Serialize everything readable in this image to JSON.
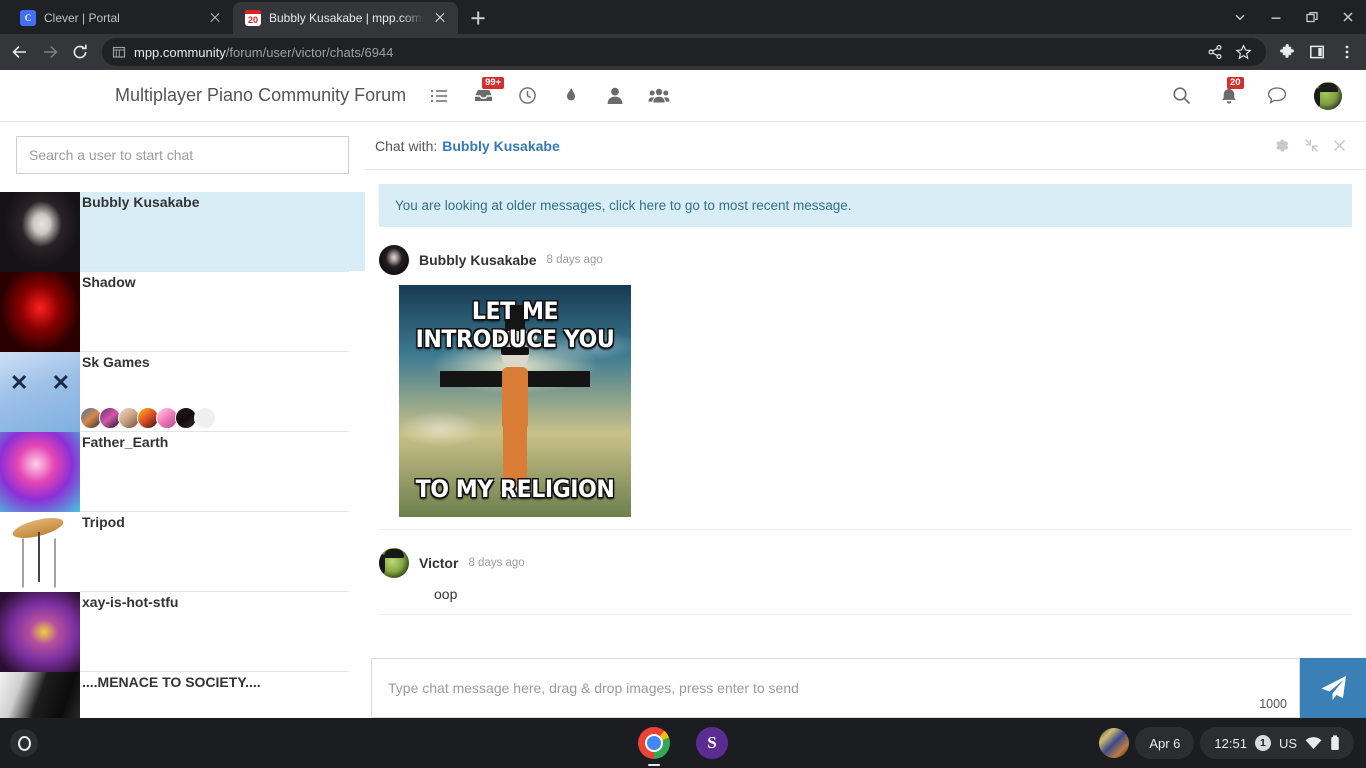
{
  "browser": {
    "tabs": [
      {
        "title": "Clever | Portal",
        "favicon": "clever-icon",
        "favicon_letter": "C",
        "active": false
      },
      {
        "title": "Bubbly Kusakabe | mpp.commu",
        "favicon": "calendar-icon",
        "favicon_badge": "20",
        "active": true
      }
    ],
    "new_tab_label": "+",
    "window_controls": [
      "chevron-down-icon",
      "minimize-icon",
      "restore-icon",
      "close-icon"
    ],
    "nav": {
      "back": "back-arrow-icon",
      "forward": "forward-arrow-icon",
      "reload": "reload-icon"
    },
    "omnibox": {
      "site_icon": "site-info-icon",
      "url_domain": "mpp.community",
      "url_path": "/forum/user/victor/chats/6944"
    },
    "omnibox_actions": [
      "share-icon",
      "bookmark-star-icon"
    ],
    "toolbar_icons": [
      "extensions-puzzle-icon",
      "side-panel-icon",
      "chrome-menu-icon"
    ]
  },
  "site": {
    "brand": "Multiplayer Piano Community Forum",
    "nav_icons": [
      {
        "name": "list-icon",
        "badge": ""
      },
      {
        "name": "inbox-icon",
        "badge": "99+"
      },
      {
        "name": "clock-icon",
        "badge": ""
      },
      {
        "name": "flame-icon",
        "badge": ""
      },
      {
        "name": "user-icon",
        "badge": ""
      },
      {
        "name": "group-icon",
        "badge": ""
      }
    ],
    "right_icons": [
      {
        "name": "search-icon",
        "badge": ""
      },
      {
        "name": "bell-icon",
        "badge": "20"
      },
      {
        "name": "chat-bubble-icon",
        "badge": ""
      }
    ],
    "avatar": "user-avatar"
  },
  "sidebar": {
    "search_placeholder": "Search a user to start chat",
    "search_value": "",
    "chats": [
      {
        "name": "Bubbly Kusakabe",
        "active": true,
        "thumb": "th-bubbly",
        "members": 0
      },
      {
        "name": "Shadow",
        "active": false,
        "thumb": "th-shadow",
        "members": 0
      },
      {
        "name": "Sk Games",
        "active": false,
        "thumb": "th-sk",
        "members": 7
      },
      {
        "name": "Father_Earth",
        "active": false,
        "thumb": "th-father",
        "members": 0
      },
      {
        "name": "Tripod",
        "active": false,
        "thumb": "th-tripod",
        "members": 0
      },
      {
        "name": "xay-is-hot-stfu",
        "active": false,
        "thumb": "th-xay",
        "members": 0
      },
      {
        "name": "....MENACE TO SOCIETY....",
        "active": false,
        "thumb": "th-menace",
        "members": 0
      }
    ]
  },
  "chat": {
    "header_label": "Chat with:",
    "peer": "Bubbly Kusakabe",
    "header_icons": [
      "gear-icon",
      "collapse-icon",
      "close-icon"
    ],
    "notice": "You are looking at older messages, click here to go to most recent message.",
    "messages": [
      {
        "author": "Bubbly Kusakabe",
        "time": "8 days ago",
        "avatar": "ava-bubbly",
        "type": "image",
        "image_alt": "meme image",
        "image_caption_top": "LET ME INTRODUCE YOU",
        "image_caption_bottom": "TO MY RELIGION"
      },
      {
        "author": "Victor",
        "time": "8 days ago",
        "avatar": "ava-victor",
        "type": "text",
        "text": "oop"
      }
    ],
    "composer": {
      "placeholder": "Type chat message here, drag & drop images, press enter to send",
      "value": "",
      "char_count": "1000",
      "send_icon": "send-paper-plane-icon"
    }
  },
  "shelf": {
    "launcher": "launcher-icon",
    "apps": [
      {
        "name": "chrome-app-icon",
        "running": true
      },
      {
        "name": "sketch-app-icon",
        "letter": "S",
        "running": false
      }
    ],
    "tray": {
      "avatar": "tray-avatar",
      "date": "Apr 6",
      "time": "12:51",
      "ime_badge": "1",
      "ime": "US",
      "icons": [
        "wifi-icon",
        "battery-icon"
      ]
    }
  },
  "colors": {
    "accent_blue": "#337ab7",
    "notice_bg": "#d9edf7",
    "notice_text": "#31708f",
    "send_btn": "#3a7fb5",
    "badge_red": "#d32f2f",
    "chrome_bg": "#202124",
    "shelf_bg": "#1c1d21"
  }
}
